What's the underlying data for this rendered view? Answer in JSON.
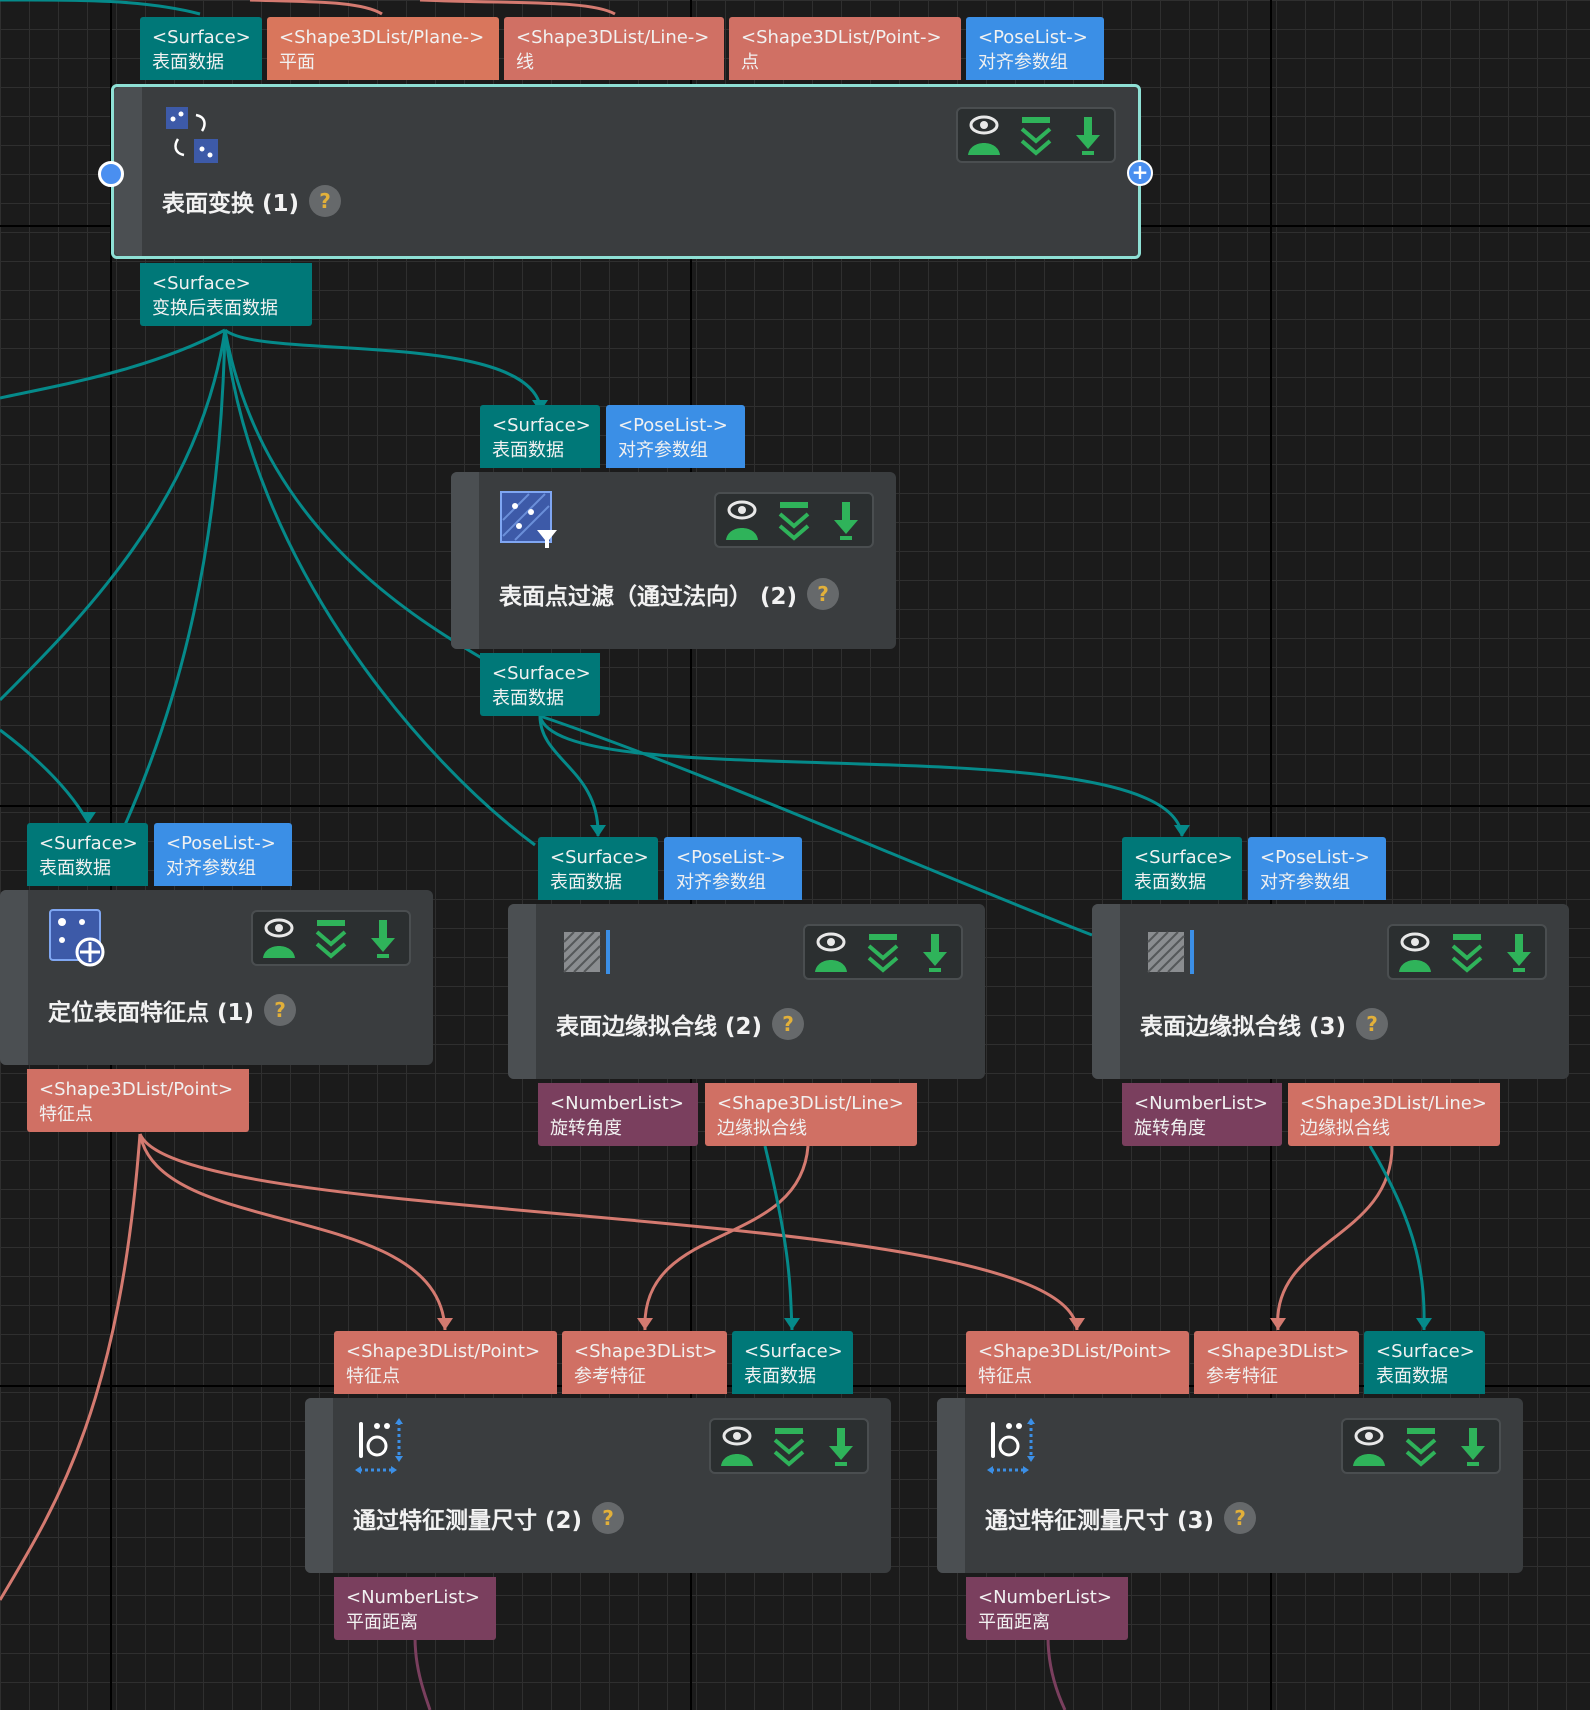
{
  "colors": {
    "teal": "#007878",
    "blue": "#3b8fe6",
    "salmon": "#d07064",
    "plum": "#7a3f5e",
    "node_bg": "#3a3d3f",
    "selected_border": "#8ee0d5",
    "wire_teal": "#058a8a",
    "wire_salmon": "#d47a70"
  },
  "nodes": {
    "surface_transform": {
      "title": "表面变换 (1)",
      "help": "?",
      "icon": "transform-icon",
      "inputs": [
        {
          "type": "<Surface>",
          "name": "表面数据"
        },
        {
          "type": "<Shape3DList/Plane->",
          "name": "平面"
        },
        {
          "type": "<Shape3DList/Line->",
          "name": "线"
        },
        {
          "type": "<Shape3DList/Point->",
          "name": "点"
        },
        {
          "type": "<PoseList->",
          "name": "对齐参数组"
        }
      ],
      "outputs": [
        {
          "type": "<Surface>",
          "name": "变换后表面数据"
        }
      ]
    },
    "surface_filter": {
      "title": "表面点过滤（通过法向） (2)",
      "help": "?",
      "icon": "filter-icon",
      "inputs": [
        {
          "type": "<Surface>",
          "name": "表面数据"
        },
        {
          "type": "<PoseList->",
          "name": "对齐参数组"
        }
      ],
      "outputs": [
        {
          "type": "<Surface>",
          "name": "表面数据"
        }
      ]
    },
    "locate_features": {
      "title": "定位表面特征点 (1)",
      "help": "?",
      "icon": "locate-icon",
      "inputs": [
        {
          "type": "<Surface>",
          "name": "表面数据"
        },
        {
          "type": "<PoseList->",
          "name": "对齐参数组"
        }
      ],
      "outputs": [
        {
          "type": "<Shape3DList/Point>",
          "name": "特征点"
        }
      ]
    },
    "edge_fit_2": {
      "title": "表面边缘拟合线 (2)",
      "help": "?",
      "icon": "edge-fit-icon",
      "inputs": [
        {
          "type": "<Surface>",
          "name": "表面数据"
        },
        {
          "type": "<PoseList->",
          "name": "对齐参数组"
        }
      ],
      "outputs": [
        {
          "type": "<NumberList>",
          "name": "旋转角度"
        },
        {
          "type": "<Shape3DList/Line>",
          "name": "边缘拟合线"
        }
      ]
    },
    "edge_fit_3": {
      "title": "表面边缘拟合线 (3)",
      "help": "?",
      "icon": "edge-fit-icon",
      "inputs": [
        {
          "type": "<Surface>",
          "name": "表面数据"
        },
        {
          "type": "<PoseList->",
          "name": "对齐参数组"
        }
      ],
      "outputs": [
        {
          "type": "<NumberList>",
          "name": "旋转角度"
        },
        {
          "type": "<Shape3DList/Line>",
          "name": "边缘拟合线"
        }
      ]
    },
    "measure_2": {
      "title": "通过特征测量尺寸 (2)",
      "help": "?",
      "icon": "measure-icon",
      "inputs": [
        {
          "type": "<Shape3DList/Point>",
          "name": "特征点"
        },
        {
          "type": "<Shape3DList>",
          "name": "参考特征"
        },
        {
          "type": "<Surface>",
          "name": "表面数据"
        }
      ],
      "outputs": [
        {
          "type": "<NumberList>",
          "name": "平面距离"
        }
      ]
    },
    "measure_3": {
      "title": "通过特征测量尺寸 (3)",
      "help": "?",
      "icon": "measure-icon",
      "inputs": [
        {
          "type": "<Shape3DList/Point>",
          "name": "特征点"
        },
        {
          "type": "<Shape3DList>",
          "name": "参考特征"
        },
        {
          "type": "<Surface>",
          "name": "表面数据"
        }
      ],
      "outputs": [
        {
          "type": "<NumberList>",
          "name": "平面距离"
        }
      ]
    }
  },
  "tool_icons": [
    "visibility-icon",
    "collapse-icon",
    "download-icon"
  ]
}
